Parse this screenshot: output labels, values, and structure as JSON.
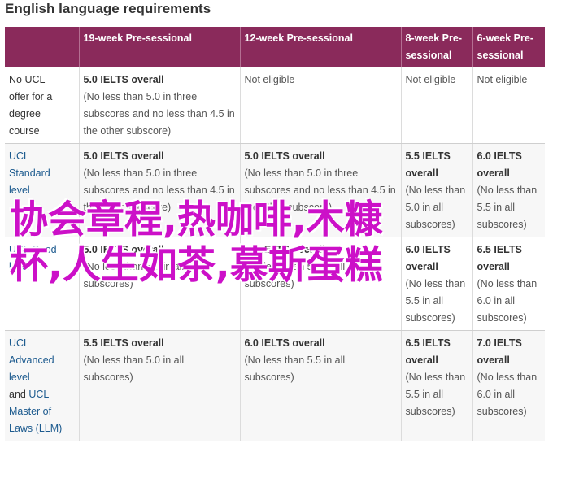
{
  "title": "English language requirements",
  "columns": [
    "",
    "19-week Pre-sessional",
    "12-week Pre-sessional",
    "8-week Pre-sessional",
    "6-week Pre-sessional"
  ],
  "rows": [
    {
      "head": [
        "No UCL",
        "offer for a",
        "degree",
        "course"
      ],
      "head_style": "dark",
      "cells": [
        {
          "score": "5.0 IELTS overall",
          "note": "(No less than 5.0 in three subscores and no less than 4.5 in the other subscore)"
        },
        {
          "score": "",
          "note": "Not eligible"
        },
        {
          "score": "",
          "note": "Not eligible"
        },
        {
          "score": "",
          "note": "Not eligible"
        }
      ]
    },
    {
      "head": [
        "UCL",
        "Standard",
        "level"
      ],
      "head_style": "blue",
      "cells": [
        {
          "score": "5.0 IELTS overall",
          "note": "(No less than 5.0 in three subscores and no less than 4.5 in the other subscore)"
        },
        {
          "score": "5.0 IELTS overall",
          "note": "(No less than 5.0 in three subscores and no less than 4.5 in the other subscore)"
        },
        {
          "score": "5.5 IELTS overall",
          "note": "(No less than 5.0 in all subscores)"
        },
        {
          "score": "6.0 IELTS overall",
          "note": "(No less than 5.5 in all subscores)"
        }
      ]
    },
    {
      "head": [
        "UCL Good",
        "level"
      ],
      "head_style": "blue",
      "cells": [
        {
          "score": "5.0 IELTS overall",
          "note": "(No less than 5.0 in all subscores)"
        },
        {
          "score": "5.5 IELTS overall",
          "note": "(No less than 5.0 in all subscores)"
        },
        {
          "score": "6.0 IELTS overall",
          "note": "(No less than 5.5 in all subscores)"
        },
        {
          "score": "6.5 IELTS overall",
          "note": "(No less than 6.0 in all subscores)"
        }
      ]
    },
    {
      "head": [
        "UCL",
        "Advanced",
        "level",
        "and UCL",
        "Master of",
        "Laws (LLM)"
      ],
      "head_style": "advanced",
      "cells": [
        {
          "score": "5.5 IELTS overall",
          "note": "(No less than 5.0 in all subscores)"
        },
        {
          "score": "6.0 IELTS overall",
          "note": "(No less than 5.5 in all subscores)"
        },
        {
          "score": "6.5 IELTS overall",
          "note": "(No less than 5.5 in all subscores)"
        },
        {
          "score": "7.0 IELTS overall",
          "note": "(No less than 6.0 in all subscores)"
        }
      ]
    }
  ],
  "overlay": {
    "line1": "协会章程,热咖啡,木糠",
    "line2": "杯,人生如茶,慕斯蛋糕"
  },
  "colors": {
    "header_bg": "#8a2a5b",
    "header_text": "#ffffff",
    "link_blue": "#1c5a8e",
    "overlay_magenta": "#cc10c8"
  }
}
